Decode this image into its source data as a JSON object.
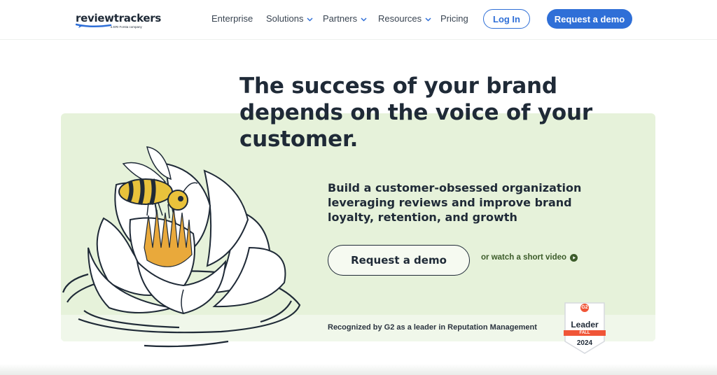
{
  "brand": {
    "name": "reviewtrackers",
    "sub": "a ERI Forsta company"
  },
  "nav": {
    "enterprise": "Enterprise",
    "solutions": "Solutions",
    "partners": "Partners",
    "resources": "Resources",
    "pricing": "Pricing",
    "login": "Log In",
    "request_demo": "Request a demo"
  },
  "hero": {
    "headline": "The success of your brand depends on the voice of your customer.",
    "subhead": "Build a customer-obsessed organization leveraging reviews and improve brand loyalty, retention, and growth",
    "cta": "Request a demo",
    "watch_link": "or watch a short video",
    "recognition": "Recognized by G2 as a leader in Reputation Management"
  },
  "badge": {
    "logo": "G2",
    "title": "Leader",
    "season": "FALL",
    "year": "2024"
  },
  "colors": {
    "accent": "#2f6fd7",
    "panel": "#e6f2da",
    "honey": "#e9a93b",
    "text": "#1f2a37"
  },
  "icons": {
    "chevron": "chevron-down-icon",
    "play": "play-circle-icon"
  }
}
